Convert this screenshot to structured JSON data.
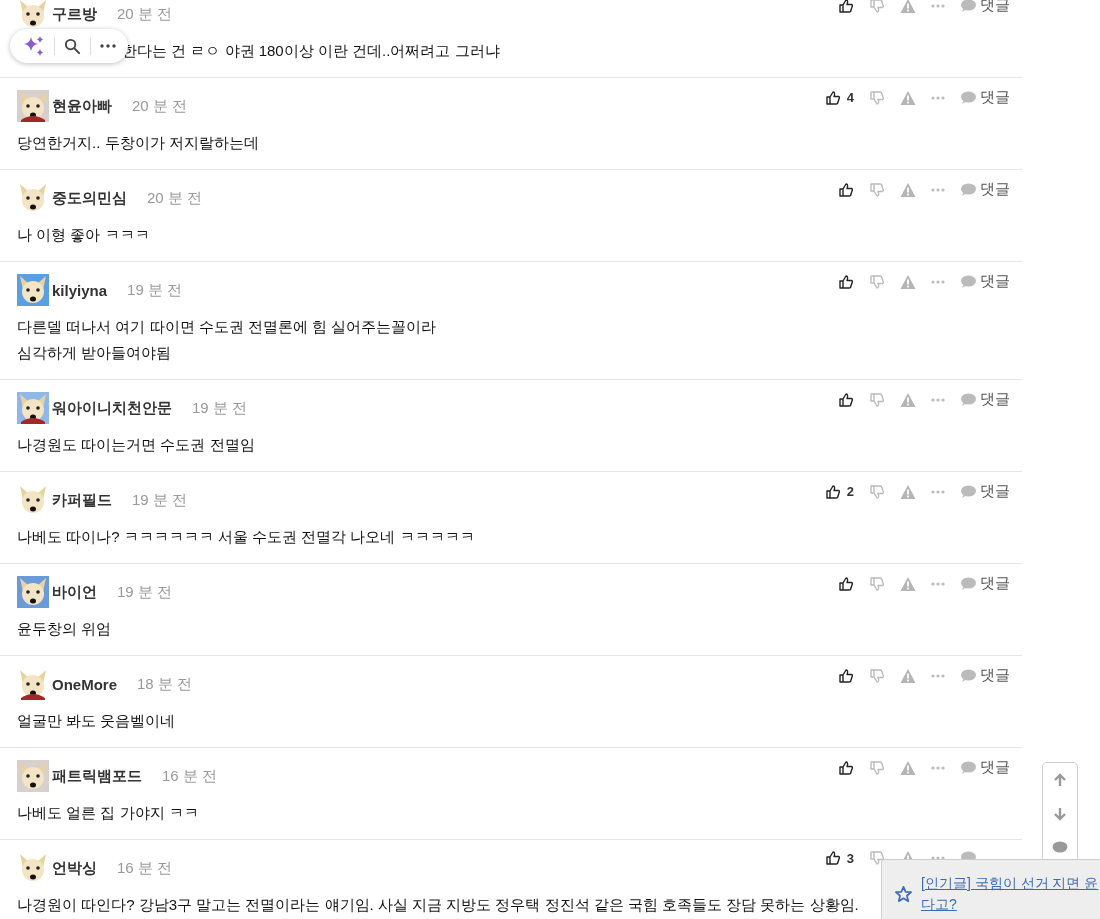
{
  "comments": [
    {
      "name": "구르방",
      "time": "20 분 전",
      "lines": [
        "한다는 건 ㄹㅇ 야권 180이상 이란 건데..어쩌려고 그러냐"
      ],
      "reply": "댓글"
    },
    {
      "name": "현윤아빠",
      "time": "20 분 전",
      "lines": [
        "당연한거지.. 두창이가 저지랄하는데"
      ],
      "likes": "4",
      "reply": "댓글"
    },
    {
      "name": "중도의민심",
      "time": "20 분 전",
      "lines": [
        "나 이형 좋아 ㅋㅋㅋ"
      ],
      "reply": "댓글"
    },
    {
      "name": "kilyiyna",
      "time": "19 분 전",
      "lines": [
        "다른델 떠나서 여기 따이면 수도권 전멸론에 힘 실어주는꼴이라",
        "심각하게 받아들여야됨"
      ],
      "reply": "댓글"
    },
    {
      "name": "워아이니치천안문",
      "time": "19 분 전",
      "lines": [
        "나경원도 따이는거면 수도권 전멸임"
      ],
      "reply": "댓글"
    },
    {
      "name": "카퍼필드",
      "time": "19 분 전",
      "lines": [
        "나베도 따이나? ㅋㅋㅋㅋㅋㅋ 서울 수도권 전멸각 나오네 ㅋㅋㅋㅋㅋ"
      ],
      "likes": "2",
      "reply": "댓글"
    },
    {
      "name": "바이언",
      "time": "19 분 전",
      "lines": [
        "윤두창의 위엄"
      ],
      "reply": "댓글"
    },
    {
      "name": "OneMore",
      "time": "18 분 전",
      "lines": [
        "얼굴만 봐도 웃음벨이네"
      ],
      "reply": "댓글"
    },
    {
      "name": "패트릭뱀포드",
      "time": "16 분 전",
      "lines": [
        "나베도 얼른 집 가야지 ㅋㅋ"
      ],
      "reply": "댓글"
    },
    {
      "name": "언박싱",
      "time": "16 분 전",
      "lines": [
        "나경원이 따인다? 강남3구 말고는 전멸이라는 얘기임. 사실 지금 지방도 정우택 정진석 같은 국힘 호족들도 장담 못하는 상황임."
      ],
      "likes": "3"
    }
  ],
  "popular_notice": {
    "lines": [
      "[인기글] 국힘이 선거 지면 윤",
      "다고?"
    ]
  }
}
